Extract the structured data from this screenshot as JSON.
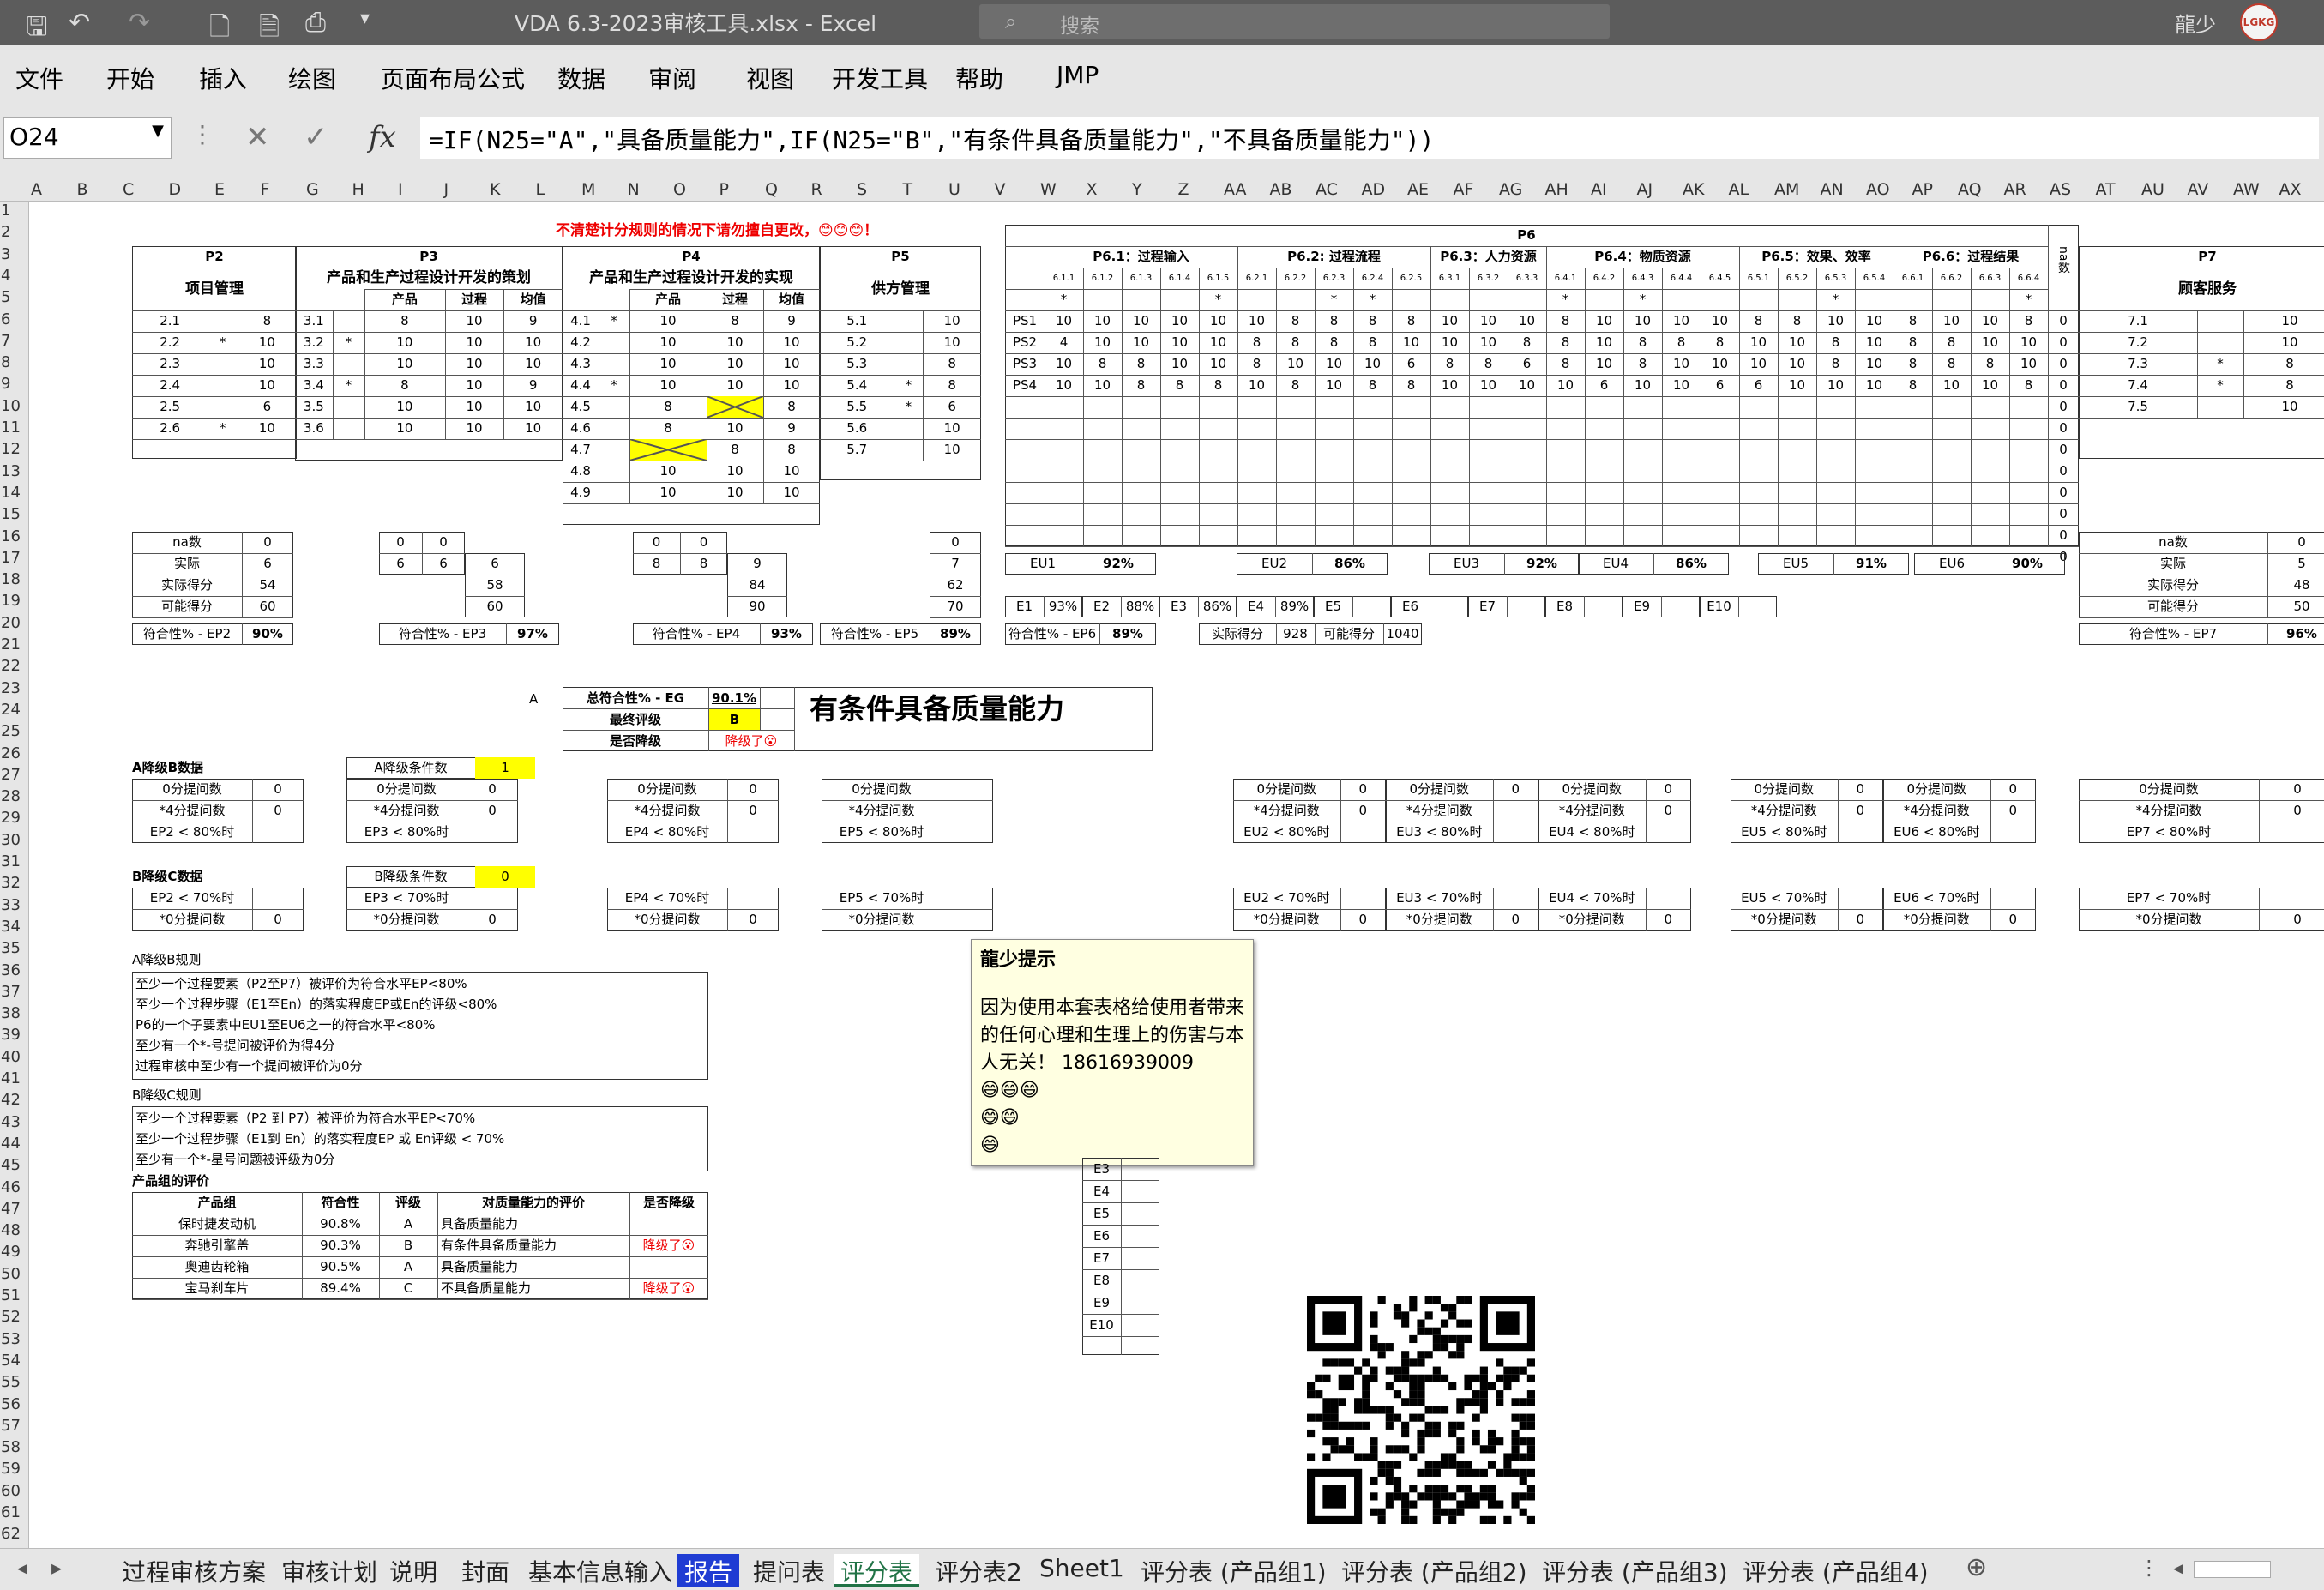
{
  "window": {
    "title": "VDA 6.3-2023审核工具.xlsx  -  Excel",
    "search_placeholder": "搜索",
    "user": "龍少",
    "avatar_text": "LGKG"
  },
  "menu": [
    "文件",
    "开始",
    "插入",
    "绘图",
    "页面布局",
    "公式",
    "数据",
    "审阅",
    "视图",
    "开发工具",
    "帮助",
    "JMP"
  ],
  "formula_bar": {
    "name_box": "O24",
    "formula": "=IF(N25=\"A\",\"具备质量能力\",IF(N25=\"B\",\"有条件具备质量能力\",\"不具备质量能力\"))"
  },
  "columns": [
    "A",
    "B",
    "C",
    "D",
    "E",
    "F",
    "G",
    "H",
    "I",
    "J",
    "K",
    "L",
    "M",
    "N",
    "O",
    "P",
    "Q",
    "R",
    "S",
    "T",
    "U",
    "V",
    "W",
    "X",
    "Y",
    "Z",
    "AA",
    "AB",
    "AC",
    "AD",
    "AE",
    "AF",
    "AG",
    "AH",
    "AI",
    "AJ",
    "AK",
    "AL",
    "AM",
    "AN",
    "AO",
    "AP",
    "AQ",
    "AR",
    "AS",
    "AT",
    "AU",
    "AV",
    "AW",
    "AX"
  ],
  "sheet": {
    "warning": "不清楚计分规则的情况下请勿擅自更改，😊😊😊！",
    "p2": {
      "code": "P2",
      "title": "项目管理",
      "rows": [
        [
          "2.1",
          "",
          "8"
        ],
        [
          "2.2",
          "*",
          "10"
        ],
        [
          "2.3",
          "",
          "10"
        ],
        [
          "2.4",
          "",
          "10"
        ],
        [
          "2.5",
          "",
          "6"
        ],
        [
          "2.6",
          "*",
          "10"
        ]
      ],
      "na_label": "na数",
      "na": "0",
      "actual_label": "实际",
      "actual": "6",
      "score_label": "实际得分",
      "score": "54",
      "possible_label": "可能得分",
      "possible": "60",
      "comp_label": "符合性% - EP2",
      "comp": "90%"
    },
    "p3": {
      "code": "P3",
      "title": "产品和生产过程设计开发的策划",
      "sub": [
        "产品",
        "过程",
        "均值"
      ],
      "rows": [
        [
          "3.1",
          "",
          "8",
          "10",
          "9"
        ],
        [
          "3.2",
          "*",
          "10",
          "10",
          "10"
        ],
        [
          "3.3",
          "",
          "10",
          "10",
          "10"
        ],
        [
          "3.4",
          "*",
          "8",
          "10",
          "9"
        ],
        [
          "3.5",
          "",
          "10",
          "10",
          "10"
        ],
        [
          "3.6",
          "",
          "10",
          "10",
          "10"
        ]
      ],
      "na": [
        "0",
        "0"
      ],
      "actual": [
        "6",
        "6",
        "6"
      ],
      "score": "58",
      "possible": "60",
      "comp_label": "符合性% - EP3",
      "comp": "97%"
    },
    "p4": {
      "code": "P4",
      "title": "产品和生产过程设计开发的实现",
      "sub": [
        "产品",
        "过程",
        "均值"
      ],
      "rows": [
        [
          "4.1",
          "*",
          "10",
          "8",
          "9"
        ],
        [
          "4.2",
          "",
          "10",
          "10",
          "10"
        ],
        [
          "4.3",
          "",
          "10",
          "10",
          "10"
        ],
        [
          "4.4",
          "*",
          "10",
          "10",
          "10"
        ],
        [
          "4.5",
          "",
          "8",
          "",
          "8"
        ],
        [
          "4.6",
          "",
          "8",
          "10",
          "9"
        ],
        [
          "4.7",
          "",
          "",
          "8",
          "8"
        ],
        [
          "4.8",
          "",
          "10",
          "10",
          "10"
        ],
        [
          "4.9",
          "",
          "10",
          "10",
          "10"
        ]
      ],
      "na": [
        "0",
        "0"
      ],
      "actual": [
        "8",
        "8",
        "9"
      ],
      "score": "84",
      "possible": "90",
      "comp_label": "符合性% - EP4",
      "comp": "93%"
    },
    "p5": {
      "code": "P5",
      "title": "供方管理",
      "rows": [
        [
          "5.1",
          "",
          "10"
        ],
        [
          "5.2",
          "",
          "10"
        ],
        [
          "5.3",
          "",
          "8"
        ],
        [
          "5.4",
          "*",
          "8"
        ],
        [
          "5.5",
          "*",
          "6"
        ],
        [
          "5.6",
          "",
          "10"
        ],
        [
          "5.7",
          "",
          "10"
        ]
      ],
      "na": "0",
      "actual": "7",
      "score": "62",
      "possible": "70",
      "comp_label": "符合性% - EP5",
      "comp": "89%"
    },
    "p6": {
      "code": "P6",
      "groups": [
        "P6.1：过程输入",
        "P6.2: 过程流程",
        "P6.3：人力资源",
        "P6.4：物质资源",
        "P6.5：效果、效率",
        "P6.6：过程结果"
      ],
      "subs": [
        "6.1.1",
        "6.1.2",
        "6.1.3",
        "6.1.4",
        "6.1.5",
        "6.2.1",
        "6.2.2",
        "6.2.3",
        "6.2.4",
        "6.2.5",
        "6.3.1",
        "6.3.2",
        "6.3.3",
        "6.4.1",
        "6.4.2",
        "6.4.3",
        "6.4.4",
        "6.4.5",
        "6.5.1",
        "6.5.2",
        "6.5.3",
        "6.5.4",
        "6.6.1",
        "6.6.2",
        "6.6.3",
        "6.6.4"
      ],
      "stars": [
        "*",
        "",
        "",
        "",
        "*",
        "",
        "",
        "*",
        "*",
        "",
        "",
        "",
        "",
        "*",
        "",
        "*",
        "",
        "",
        "",
        "",
        "*",
        "",
        "",
        "",
        "",
        "*"
      ],
      "na_col": "na数",
      "ps": [
        {
          "name": "PS1",
          "v": [
            "10",
            "10",
            "10",
            "10",
            "10",
            "10",
            "8",
            "8",
            "8",
            "8",
            "10",
            "10",
            "10",
            "8",
            "10",
            "10",
            "10",
            "10",
            "8",
            "8",
            "10",
            "10",
            "8",
            "10",
            "10",
            "8"
          ],
          "na": "0"
        },
        {
          "name": "PS2",
          "v": [
            "4",
            "10",
            "10",
            "10",
            "10",
            "8",
            "8",
            "8",
            "8",
            "10",
            "10",
            "10",
            "8",
            "8",
            "10",
            "8",
            "8",
            "8",
            "10",
            "10",
            "8",
            "10",
            "8",
            "8",
            "10",
            "10"
          ],
          "na": "0"
        },
        {
          "name": "PS3",
          "v": [
            "10",
            "8",
            "8",
            "10",
            "10",
            "8",
            "10",
            "10",
            "10",
            "6",
            "8",
            "8",
            "6",
            "8",
            "10",
            "8",
            "10",
            "10",
            "10",
            "10",
            "8",
            "10",
            "8",
            "8",
            "8",
            "10"
          ],
          "na": "0"
        },
        {
          "name": "PS4",
          "v": [
            "10",
            "10",
            "8",
            "8",
            "8",
            "10",
            "8",
            "10",
            "8",
            "8",
            "10",
            "10",
            "10",
            "10",
            "6",
            "10",
            "10",
            "6",
            "6",
            "10",
            "10",
            "10",
            "8",
            "10",
            "10",
            "8"
          ],
          "na": "0"
        }
      ],
      "empty_na": [
        "0",
        "0",
        "0",
        "0",
        "0",
        "0",
        "0",
        "0",
        "0",
        "0",
        "0"
      ],
      "eu": [
        [
          "EU1",
          "92%"
        ],
        [
          "EU2",
          "86%"
        ],
        [
          "EU3",
          "92%"
        ],
        [
          "EU4",
          "86%"
        ],
        [
          "EU5",
          "91%"
        ],
        [
          "EU6",
          "90%"
        ]
      ],
      "e": [
        [
          "E1",
          "93%"
        ],
        [
          "E2",
          "88%"
        ],
        [
          "E3",
          "86%"
        ],
        [
          "E4",
          "89%"
        ],
        [
          "E5",
          ""
        ],
        [
          "E6",
          ""
        ],
        [
          "E7",
          ""
        ],
        [
          "E8",
          ""
        ],
        [
          "E9",
          ""
        ],
        [
          "E10",
          ""
        ]
      ],
      "comp_label": "符合性% - EP6",
      "comp": "89%",
      "score_label": "实际得分",
      "score": "928",
      "possible_label": "可能得分",
      "possible": "1040"
    },
    "p7": {
      "code": "P7",
      "title": "顾客服务",
      "rows": [
        [
          "7.1",
          "",
          "10"
        ],
        [
          "7.2",
          "",
          "10"
        ],
        [
          "7.3",
          "*",
          "8"
        ],
        [
          "7.4",
          "*",
          "8"
        ],
        [
          "7.5",
          "",
          "10"
        ]
      ],
      "na_label": "na数",
      "na": "0",
      "actual_label": "实际",
      "actual": "5",
      "score_label": "实际得分",
      "score": "48",
      "possible_label": "可能得分",
      "possible": "50",
      "comp_label": "符合性% - EP7",
      "comp": "96%"
    },
    "summary": {
      "a_label": "A",
      "total_label": "总符合性% - EG",
      "total": "90.1%",
      "rating_label": "最终评级",
      "rating": "B",
      "downgrade_label": "是否降级",
      "downgrade": "降级了😮",
      "result": "有条件具备质量能力"
    },
    "a_down": {
      "title": "A降级B数据",
      "cond_label": "A降级条件数",
      "cond": "1",
      "zero_label": "0分提问数",
      "four_label": "*4分提问数",
      "lt80": "< 80%时"
    },
    "b_down": {
      "title": "B降级C数据",
      "cond_label": "B降级条件数",
      "cond": "0",
      "lt70": "< 70%时",
      "zero_label": "*0分提问数"
    },
    "rule_a": {
      "title": "A降级B规则",
      "lines": [
        "至少一个过程要素（P2至P7）被评价为符合水平EP<80%",
        "至少一个过程步骤（E1至En）的落实程度EP或En的评级<80%",
        "P6的一个子要素中EU1至EU6之一的符合水平<80%",
        "至少有一个*-号提问被评价为得4分",
        "过程审核中至少有一个提问被评价为0分"
      ]
    },
    "rule_b": {
      "title": "B降级C规则",
      "lines": [
        "至少一个过程要素（P2 到 P7）被评价为符合水平EP<70%",
        "至少一个过程步骤（E1到 En）的落实程度EP 或 En评级 < 70%",
        "至少有一个*-星号问题被评级为0分"
      ]
    },
    "pg": {
      "title": "产品组的评价",
      "headers": [
        "产品组",
        "符合性",
        "评级",
        "对质量能力的评价",
        "是否降级"
      ],
      "rows": [
        [
          "保时捷发动机",
          "90.8%",
          "A",
          "具备质量能力",
          ""
        ],
        [
          "奔驰引擎盖",
          "90.3%",
          "B",
          "有条件具备质量能力",
          "降级了😮"
        ],
        [
          "奥迪齿轮箱",
          "90.5%",
          "A",
          "具备质量能力",
          ""
        ],
        [
          "宝马刹车片",
          "89.4%",
          "C",
          "不具备质量能力",
          "降级了😮"
        ]
      ]
    },
    "tooltip": {
      "title": "龍少提示",
      "body": "因为使用本套表格给使用者带来的任何心理和生理上的伤害与本人无关！ 18616939009",
      "emoji1": "😄😄😄",
      "emoji2": "😄😄",
      "emoji3": "😄"
    }
  },
  "sheet_tabs": [
    "过程审核方案",
    "审核计划",
    "说明",
    "封面",
    "基本信息输入",
    "报告",
    "提问表",
    "评分表",
    "评分表2",
    "Sheet1",
    "评分表 (产品组1)",
    "评分表 (产品组2)",
    "评分表 (产品组3)",
    "评分表 (产品组4)"
  ],
  "active_tab": "评分表",
  "colors": {
    "highlight": "#ffff00",
    "warning": "#e00000",
    "active_tab": "#217346",
    "report_tab": "#1f3cd3"
  }
}
